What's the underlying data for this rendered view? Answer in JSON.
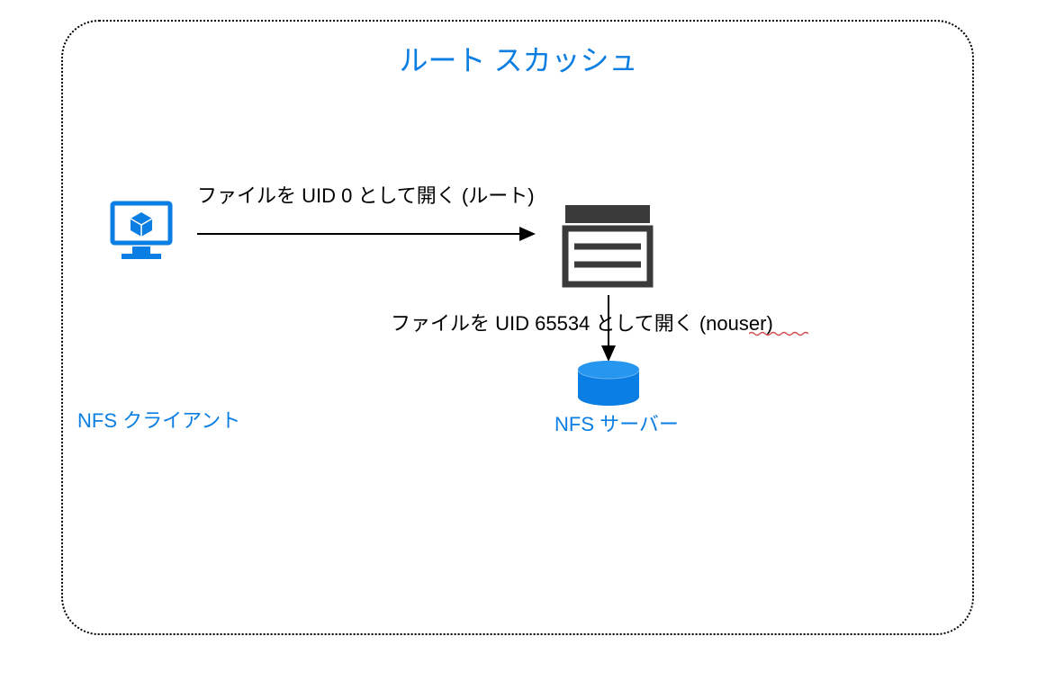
{
  "title": "ルート スカッシュ",
  "arrow1_label": "ファイルを UID 0 として開く (ルート)",
  "arrow2_label": "ファイルを UID 65534 として開く (nouser)",
  "client_label": "NFS クライアント",
  "server_label": "NFS サーバー",
  "colors": {
    "accent": "#0a7ee2",
    "icon_dark": "#3a3a3a",
    "db_blue": "#0a7ee2"
  },
  "icons": {
    "client": "monitor-cube-icon",
    "server": "server-window-icon",
    "database": "database-cylinder-icon"
  }
}
